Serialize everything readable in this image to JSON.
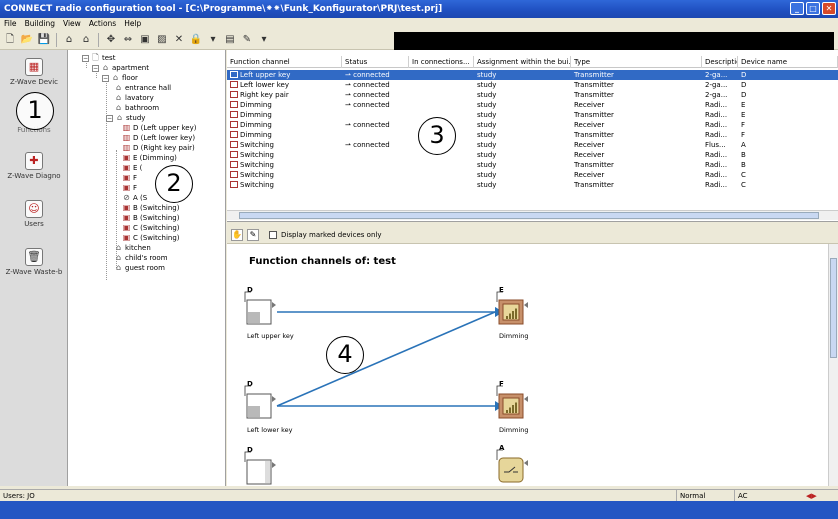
{
  "window": {
    "title": "CONNECT radio configuration tool - [C:\\Programme\\⁕⁕\\Funk_Konfigurator\\PRJ\\test.prj]"
  },
  "menu": [
    "File",
    "Building",
    "View",
    "Actions",
    "Help"
  ],
  "nav": [
    {
      "label": "Z-Wave Devic",
      "icon": "device-icon"
    },
    {
      "label": "Functions",
      "icon": "functions-icon"
    },
    {
      "label": "Z-Wave Diagno",
      "icon": "diagnostics-icon"
    },
    {
      "label": "Users",
      "icon": "users-icon"
    },
    {
      "label": "Z-Wave Waste-b",
      "icon": "waste-bin-icon"
    }
  ],
  "tree": {
    "root": "test",
    "building": "apartment",
    "floor": "floor",
    "rooms_before": [
      "entrance hall",
      "lavatory",
      "bathroom"
    ],
    "study": "study",
    "study_children": [
      "D (Left upper key)",
      "D (Left lower key)",
      "D (Right key pair)",
      "E (Dimming)",
      "E (",
      "F",
      "F",
      "A (S",
      "B (Switching)",
      "B (Switching)",
      "C (Switching)",
      "C (Switching)"
    ],
    "rooms_after": [
      "kitchen",
      "child's room",
      "guest room"
    ]
  },
  "table": {
    "columns": [
      "Function channel",
      "Status",
      "In connections...",
      "Assignment within the bui...",
      "Type",
      "Description",
      "Device name"
    ],
    "rows": [
      [
        "Left upper key",
        "connected",
        "",
        "study",
        "Transmitter",
        "2-ga...",
        "D"
      ],
      [
        "Left lower key",
        "connected",
        "",
        "study",
        "Transmitter",
        "2-ga...",
        "D"
      ],
      [
        "Right key pair",
        "connected",
        "",
        "study",
        "Transmitter",
        "2-ga...",
        "D"
      ],
      [
        "Dimming",
        "connected",
        "",
        "study",
        "Receiver",
        "Radi...",
        "E"
      ],
      [
        "Dimming",
        "",
        "",
        "study",
        "Transmitter",
        "Radi...",
        "E"
      ],
      [
        "Dimming",
        "connected",
        "",
        "study",
        "Receiver",
        "Radi...",
        "F"
      ],
      [
        "Dimming",
        "",
        "",
        "study",
        "Transmitter",
        "Radi...",
        "F"
      ],
      [
        "Switching",
        "connected",
        "",
        "study",
        "Receiver",
        "Flus...",
        "A"
      ],
      [
        "Switching",
        "",
        "",
        "study",
        "Receiver",
        "Radi...",
        "B"
      ],
      [
        "Switching",
        "",
        "",
        "study",
        "Transmitter",
        "Radi...",
        "B"
      ],
      [
        "Switching",
        "",
        "",
        "study",
        "Receiver",
        "Radi...",
        "C"
      ],
      [
        "Switching",
        "",
        "",
        "study",
        "Transmitter",
        "Radi...",
        "C"
      ]
    ]
  },
  "diagram": {
    "toolbar_checkbox": "Display marked devices only",
    "title": "Function channels of: test",
    "nodes": [
      {
        "device": "D",
        "label": "Left upper key"
      },
      {
        "device": "E",
        "label": "Dimming"
      },
      {
        "device": "D",
        "label": "Left lower key"
      },
      {
        "device": "F",
        "label": "Dimming"
      },
      {
        "device": "D",
        "label": ""
      },
      {
        "device": "A",
        "label": ""
      }
    ]
  },
  "statusbar": {
    "user": "Users: JO",
    "mode": "Normal",
    "power": "AC"
  },
  "markers": [
    "1",
    "2",
    "3",
    "4"
  ]
}
